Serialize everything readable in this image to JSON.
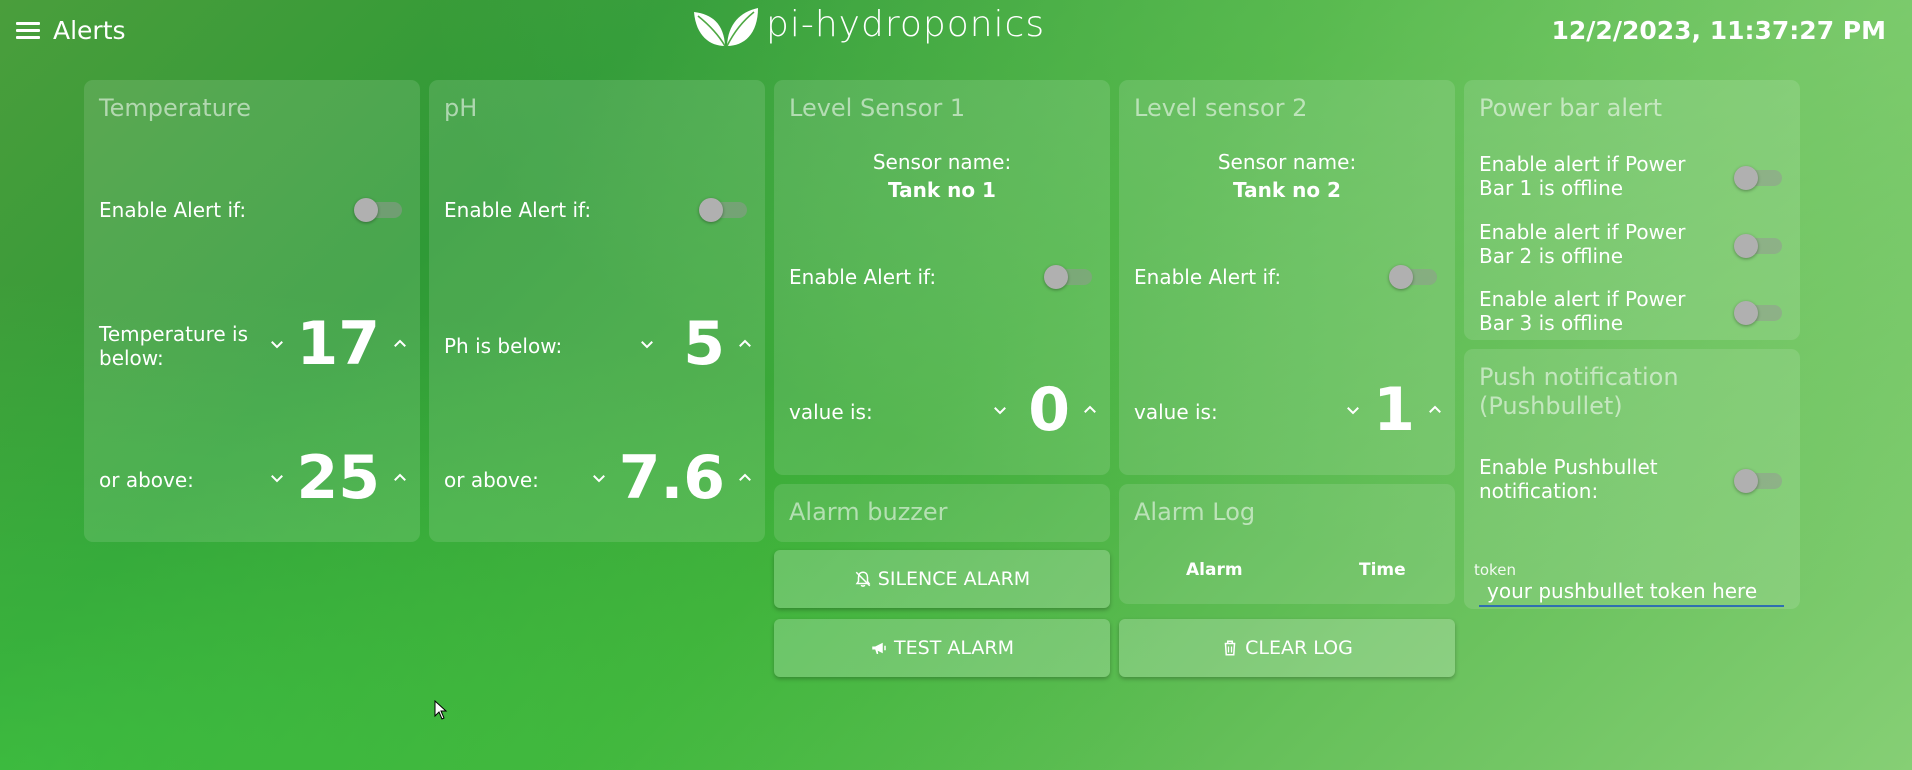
{
  "header": {
    "title": "Alerts",
    "logo_text": "pi-hydroponics",
    "datetime": "12/2/2023, 11:37:27 PM"
  },
  "temperature": {
    "title": "Temperature",
    "enable_label": "Enable Alert if:",
    "below_label": "Temperature is below:",
    "below_value": "17",
    "above_label": "or above:",
    "above_value": "25"
  },
  "ph": {
    "title": "pH",
    "enable_label": "Enable Alert if:",
    "below_label": "Ph is below:",
    "below_value": "5",
    "above_label": "or above:",
    "above_value": "7.6"
  },
  "level1": {
    "title": "Level Sensor 1",
    "sensor_name_label": "Sensor name:",
    "sensor_name": "Tank no 1",
    "enable_label": "Enable Alert if:",
    "value_label": "value is:",
    "value": "0"
  },
  "level2": {
    "title": "Level sensor 2",
    "sensor_name_label": "Sensor name:",
    "sensor_name": "Tank no 2",
    "enable_label": "Enable Alert if:",
    "value_label": "value is:",
    "value": "1"
  },
  "power": {
    "title": "Power bar alert",
    "items": [
      {
        "label": "Enable alert if Power Bar 1 is offline"
      },
      {
        "label": "Enable alert if Power Bar 2 is offline"
      },
      {
        "label": "Enable alert if Power Bar 3 is offline"
      }
    ]
  },
  "buzzer": {
    "title": "Alarm buzzer",
    "silence_label": "SILENCE ALARM",
    "test_label": "TEST ALARM"
  },
  "log": {
    "title": "Alarm Log",
    "col_alarm": "Alarm",
    "col_time": "Time",
    "clear_label": "CLEAR LOG"
  },
  "push": {
    "title": "Push notification (Pushbullet)",
    "enable_label": "Enable Pushbullet notification:",
    "token_label": "token",
    "token_placeholder": "your pushbullet token here"
  }
}
